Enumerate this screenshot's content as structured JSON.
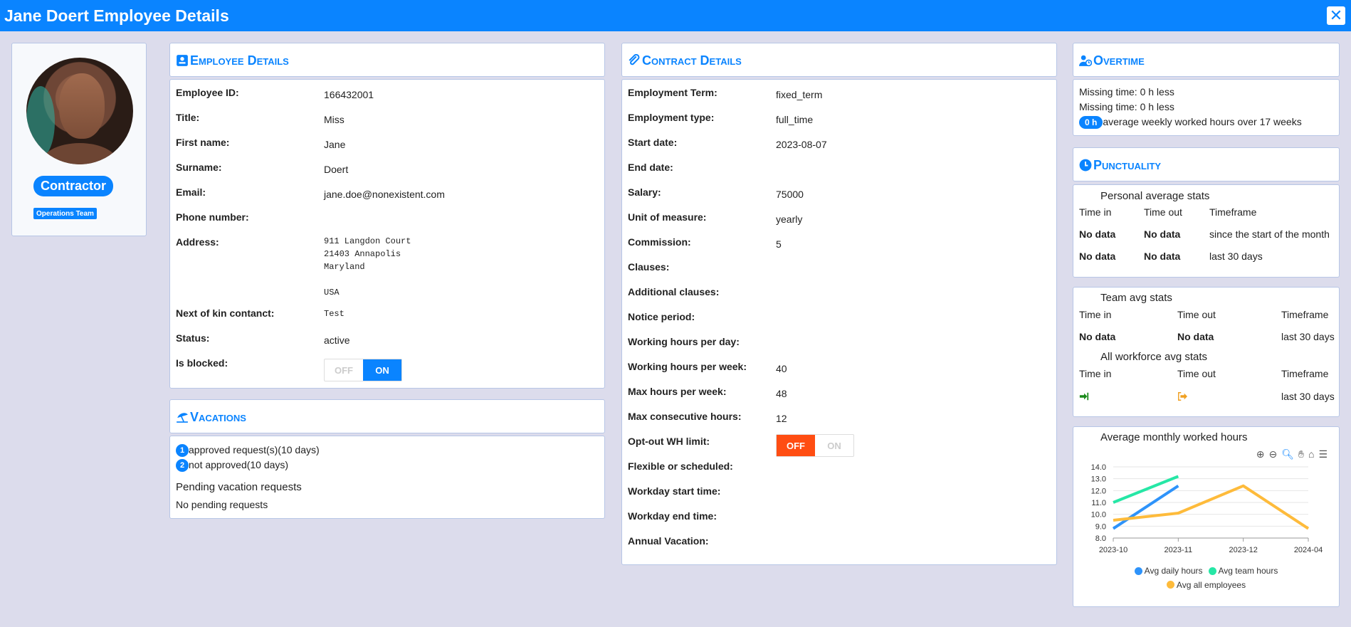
{
  "window": {
    "title": "Jane Doert Employee Details"
  },
  "profile": {
    "role_badge": "Contractor",
    "team_badge": "Operations Team"
  },
  "employee": {
    "heading": "Employee Details",
    "fields": {
      "id_label": "Employee ID:",
      "id_value": "166432001",
      "title_label": "Title:",
      "title_value": "Miss",
      "first_label": "First name:",
      "first_value": "Jane",
      "surname_label": "Surname:",
      "surname_value": "Doert",
      "email_label": "Email:",
      "email_value": "jane.doe@nonexistent.com",
      "phone_label": "Phone number:",
      "address_label": "Address:",
      "address_lines": [
        "911 Langdon Court",
        "21403 Annapolis",
        "Maryland",
        "",
        "USA"
      ],
      "kin_label": "Next of kin contanct:",
      "kin_value": "Test",
      "status_label": "Status:",
      "status_value": "active",
      "blocked_label": "Is blocked:"
    },
    "blocked_toggle": {
      "off": "OFF",
      "on": "ON",
      "state": "ON"
    }
  },
  "vacations": {
    "heading": "Vacations",
    "approved_count": "1",
    "approved_text": "approved request(s)(10  days)",
    "not_approved_count": "2",
    "not_approved_text": "not approved(10  days)",
    "pending_title": "Pending vacation requests",
    "pending_value": "No pending requests"
  },
  "contract": {
    "heading": "Contract Details",
    "rows": [
      {
        "label": "Employment Term:",
        "value": "fixed_term"
      },
      {
        "label": "Employment type:",
        "value": "full_time"
      },
      {
        "label": "Start date:",
        "value": "2023-08-07"
      },
      {
        "label": "End date:",
        "value": ""
      },
      {
        "label": "Salary:",
        "value": "75000"
      },
      {
        "label": "Unit of measure:",
        "value": "yearly"
      },
      {
        "label": "Commission:",
        "value": "5"
      },
      {
        "label": "Clauses:",
        "value": ""
      },
      {
        "label": "Additional clauses:",
        "value": ""
      },
      {
        "label": "Notice period:",
        "value": ""
      },
      {
        "label": "Working hours per day:",
        "value": ""
      },
      {
        "label": "Working hours per week:",
        "value": "40"
      },
      {
        "label": "Max hours per week:",
        "value": "48"
      },
      {
        "label": "Max consecutive hours:",
        "value": "12"
      },
      {
        "label": "Opt-out WH limit:",
        "value": ""
      },
      {
        "label": "Flexible or scheduled:",
        "value": ""
      },
      {
        "label": "Workday start time:",
        "value": ""
      },
      {
        "label": "Workday end time:",
        "value": ""
      },
      {
        "label": "Annual Vacation:",
        "value": ""
      }
    ],
    "optout_toggle": {
      "off": "OFF",
      "on": "ON",
      "state": "OFF"
    }
  },
  "overtime": {
    "heading": "Overtime",
    "line1": "Missing time: 0 h less",
    "line2": "Missing time: 0 h less",
    "badge": "0 h",
    "line3": "average weekly worked hours over 17 weeks"
  },
  "punctuality": {
    "heading": "Punctuality",
    "personal": {
      "title": "Personal average stats",
      "headers": [
        "Time in",
        "Time out",
        "Timeframe"
      ],
      "rows": [
        [
          "No data",
          "No data",
          "since the start of the month"
        ],
        [
          "No data",
          "No data",
          "last 30 days"
        ]
      ]
    },
    "team": {
      "title": "Team avg stats",
      "headers": [
        "Time in",
        "Time out",
        "Timeframe"
      ],
      "rows": [
        [
          "No data",
          "No data",
          "last 30 days"
        ]
      ]
    },
    "all": {
      "title": "All workforce avg stats",
      "headers": [
        "Time in",
        "Time out",
        "Timeframe"
      ],
      "timeframe": "last 30 days",
      "in_icon": "sign-in-icon",
      "out_icon": "sign-out-icon"
    }
  },
  "chart_data": {
    "type": "line",
    "title": "Average monthly worked hours",
    "categories": [
      "2023-10",
      "2023-11",
      "2023-12",
      "2024-04"
    ],
    "yticks": [
      "14.0",
      "13.0",
      "12.0",
      "11.0",
      "10.0",
      "9.0",
      "8.0"
    ],
    "ylim": [
      8,
      14
    ],
    "series": [
      {
        "name": "Avg daily hours",
        "color": "#2e93fa",
        "values": [
          8.8,
          12.4,
          null,
          null
        ]
      },
      {
        "name": "Avg team hours",
        "color": "#26e7a6",
        "values": [
          11.0,
          13.2,
          null,
          null
        ]
      },
      {
        "name": "Avg all employees",
        "color": "#febb3b",
        "values": [
          9.5,
          10.1,
          12.4,
          8.8
        ]
      }
    ],
    "legend": "bottom",
    "grid": true
  }
}
